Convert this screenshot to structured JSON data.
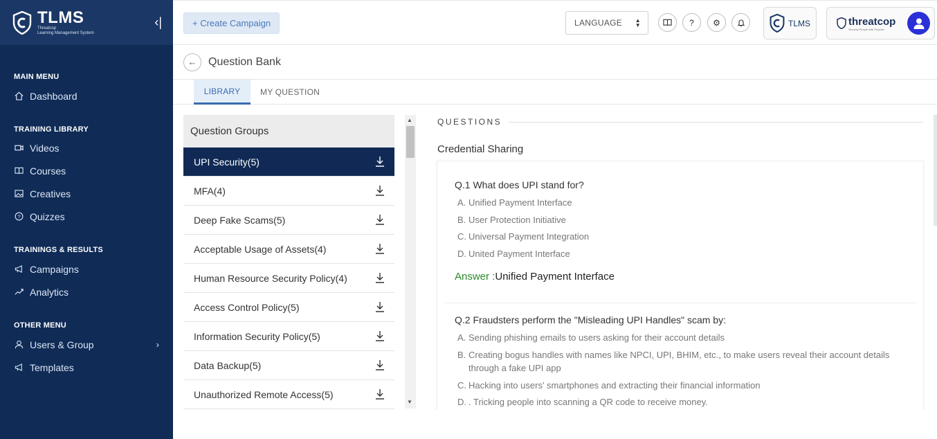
{
  "brand": {
    "title": "TLMS",
    "sub1": "Threatcop",
    "sub2": "Learning Management System"
  },
  "sidebar": {
    "sections": [
      {
        "heading": "MAIN MENU",
        "items": [
          {
            "label": "Dashboard",
            "icon": "home-icon"
          }
        ]
      },
      {
        "heading": "TRAINING LIBRARY",
        "items": [
          {
            "label": "Videos",
            "icon": "video-icon"
          },
          {
            "label": "Courses",
            "icon": "book-icon"
          },
          {
            "label": "Creatives",
            "icon": "image-icon"
          },
          {
            "label": "Quizzes",
            "icon": "question-circle-icon"
          }
        ]
      },
      {
        "heading": "TRAININGS & RESULTS",
        "items": [
          {
            "label": "Campaigns",
            "icon": "megaphone-icon"
          },
          {
            "label": "Analytics",
            "icon": "trend-icon"
          }
        ]
      },
      {
        "heading": "OTHER MENU",
        "items": [
          {
            "label": "Users & Group",
            "icon": "user-icon"
          },
          {
            "label": "Templates",
            "icon": "megaphone-icon"
          }
        ]
      }
    ]
  },
  "topbar": {
    "create_label": "+ Create Campaign",
    "language_label": "LANGUAGE",
    "tlms_label": "TLMS",
    "brand_label": "threatcop",
    "brand_sub": "Security People with Peoples"
  },
  "page": {
    "title": "Question Bank",
    "tabs": [
      "LIBRARY",
      "MY QUESTION"
    ],
    "active_tab": "LIBRARY"
  },
  "groups": {
    "header": "Question Groups",
    "items": [
      "UPI Security(5)",
      "MFA(4)",
      "Deep Fake Scams(5)",
      "Acceptable Usage of Assets(4)",
      "Human Resource Security Policy(4)",
      "Access Control Policy(5)",
      "Information Security Policy(5)",
      "Data Backup(5)",
      "Unauthorized Remote Access(5)"
    ],
    "active_index": 0
  },
  "questions": {
    "heading": "QUESTIONS",
    "category": "Credential Sharing",
    "items": [
      {
        "title": "Q.1 What does UPI stand for?",
        "options": [
          {
            "letter": "A.",
            "text": "Unified Payment Interface"
          },
          {
            "letter": "B.",
            "text": "User Protection Initiative"
          },
          {
            "letter": "C.",
            "text": "Universal Payment Integration"
          },
          {
            "letter": "D.",
            "text": "United Payment Interface"
          }
        ],
        "answer_label": "Answer :",
        "answer": "Unified Payment Interface"
      },
      {
        "title": "Q.2 Fraudsters perform the \"Misleading UPI Handles\" scam by:",
        "options": [
          {
            "letter": "A.",
            "text": "Sending phishing emails to users asking for their account details"
          },
          {
            "letter": "B.",
            "text": "Creating bogus handles with names like NPCI, UPI, BHIM, etc., to make users reveal their account details through a fake UPI app"
          },
          {
            "letter": "C.",
            "text": "Hacking into users' smartphones and extracting their financial information"
          },
          {
            "letter": "D.",
            "text": ". Tricking people into scanning a QR code to receive money."
          }
        ]
      }
    ]
  },
  "colors": {
    "sidebar_bg": "#0f2b56",
    "active_group_bg": "#102a55",
    "accent": "#3a6bb0",
    "answer_green": "#2b8a2b",
    "avatar_bg": "#2a2fd8"
  }
}
